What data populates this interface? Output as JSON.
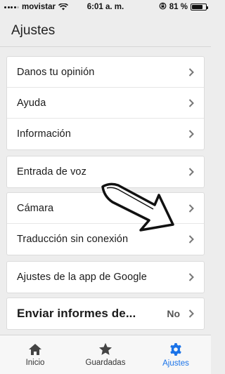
{
  "status_bar": {
    "carrier": "movistar",
    "time": "6:01 a. m.",
    "battery": "81 %",
    "battery_level": 0.81
  },
  "header": {
    "title": "Ajustes"
  },
  "groups": [
    {
      "items": [
        {
          "label": "Danos tu opinión"
        },
        {
          "label": "Ayuda"
        },
        {
          "label": "Información"
        }
      ]
    },
    {
      "items": [
        {
          "label": "Entrada de voz"
        }
      ]
    },
    {
      "items": [
        {
          "label": "Cámara"
        },
        {
          "label": "Traducción sin conexión"
        }
      ]
    },
    {
      "items": [
        {
          "label": "Ajustes de la app de Google"
        }
      ]
    },
    {
      "items": [
        {
          "label": "Enviar informes de...",
          "value": "No"
        }
      ]
    }
  ],
  "bottom_nav": {
    "items": [
      {
        "label": "Inicio",
        "icon": "home-icon",
        "active": false
      },
      {
        "label": "Guardadas",
        "icon": "star-icon",
        "active": false
      },
      {
        "label": "Ajustes",
        "icon": "gear-icon",
        "active": true
      }
    ]
  },
  "colors": {
    "accent": "#1a73e8",
    "background": "#ededed",
    "card": "#ffffff"
  }
}
